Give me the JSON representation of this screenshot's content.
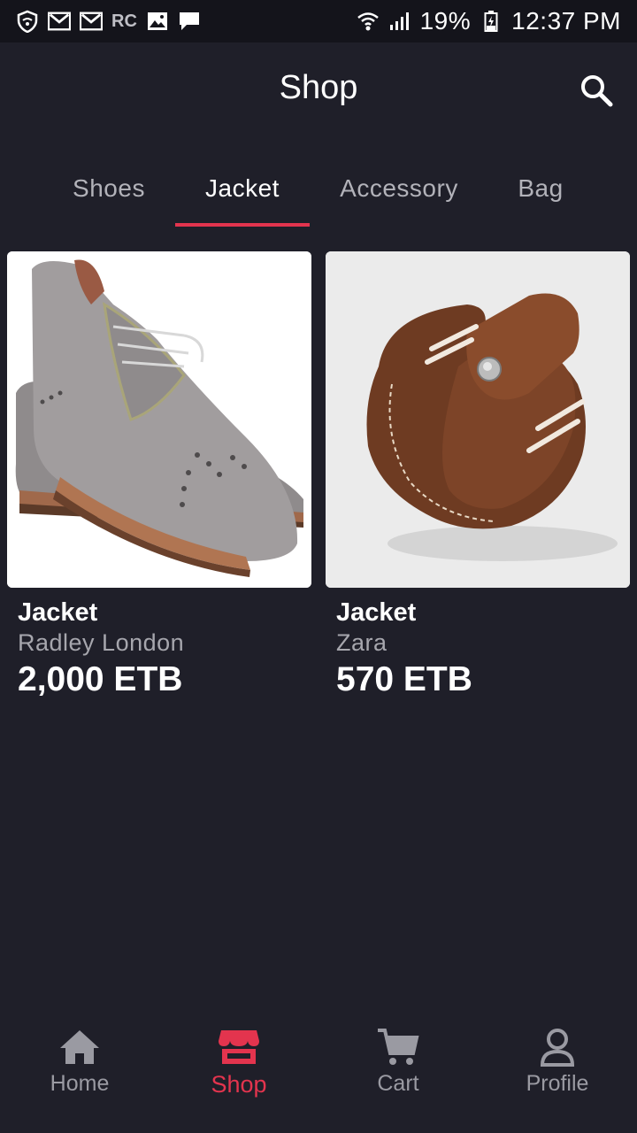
{
  "status_bar": {
    "left_icons": [
      "shield-wifi-icon",
      "gmail-icon",
      "gmail-icon",
      "rc-icon",
      "gallery-icon",
      "chat-icon"
    ],
    "rc_label": "RC",
    "battery_percent": "19%",
    "time": "12:37 PM"
  },
  "header": {
    "title": "Shop"
  },
  "tabs": [
    {
      "label": "Shoes",
      "active": false
    },
    {
      "label": "Jacket",
      "active": true
    },
    {
      "label": "Accessory",
      "active": false
    },
    {
      "label": "Bag",
      "active": false
    }
  ],
  "products": [
    {
      "title": "Jacket",
      "brand": "Radley London",
      "price": "2,000 ETB",
      "image": "grey suede oxford shoes"
    },
    {
      "title": "Jacket",
      "brand": "Zara",
      "price": "570 ETB",
      "image": "brown leather knife sheath"
    }
  ],
  "bottom_nav": [
    {
      "label": "Home",
      "icon": "home-icon",
      "active": false
    },
    {
      "label": "Shop",
      "icon": "shop-icon",
      "active": true
    },
    {
      "label": "Cart",
      "icon": "cart-icon",
      "active": false
    },
    {
      "label": "Profile",
      "icon": "profile-icon",
      "active": false
    }
  ],
  "colors": {
    "background": "#1f1f29",
    "status_bar": "#14141b",
    "accent": "#e3344e",
    "text_secondary": "#a6a6ad"
  }
}
